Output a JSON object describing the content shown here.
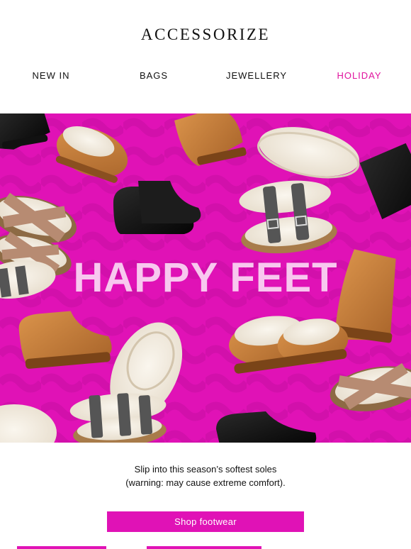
{
  "brand": {
    "logo_text": "ACCESSORIZE"
  },
  "nav": {
    "items": [
      {
        "label": "NEW IN",
        "color": "#111111"
      },
      {
        "label": "BAGS",
        "color": "#111111"
      },
      {
        "label": "JEWELLERY",
        "color": "#111111"
      },
      {
        "label": "HOLIDAY",
        "color": "#e0139e"
      }
    ]
  },
  "hero": {
    "title": "HAPPY FEET",
    "background_color": "#e012b6",
    "pattern_color": "#c70fa2",
    "title_color": "#f8c8ef",
    "image_subject": "assorted slippers: tan suede mini boots, black suede boots, cream fluffy sliders, crossover sliders, buckle-strap footbed sandals"
  },
  "body": {
    "line1": "Slip into this season’s softest soles",
    "line2": "(warning: may cause extreme comfort)."
  },
  "cta": {
    "label": "Shop footwear",
    "background_color": "#e012b6",
    "text_color": "#ffffff"
  },
  "colors": {
    "accent": "#e012b6",
    "text": "#111111",
    "background": "#ffffff"
  }
}
